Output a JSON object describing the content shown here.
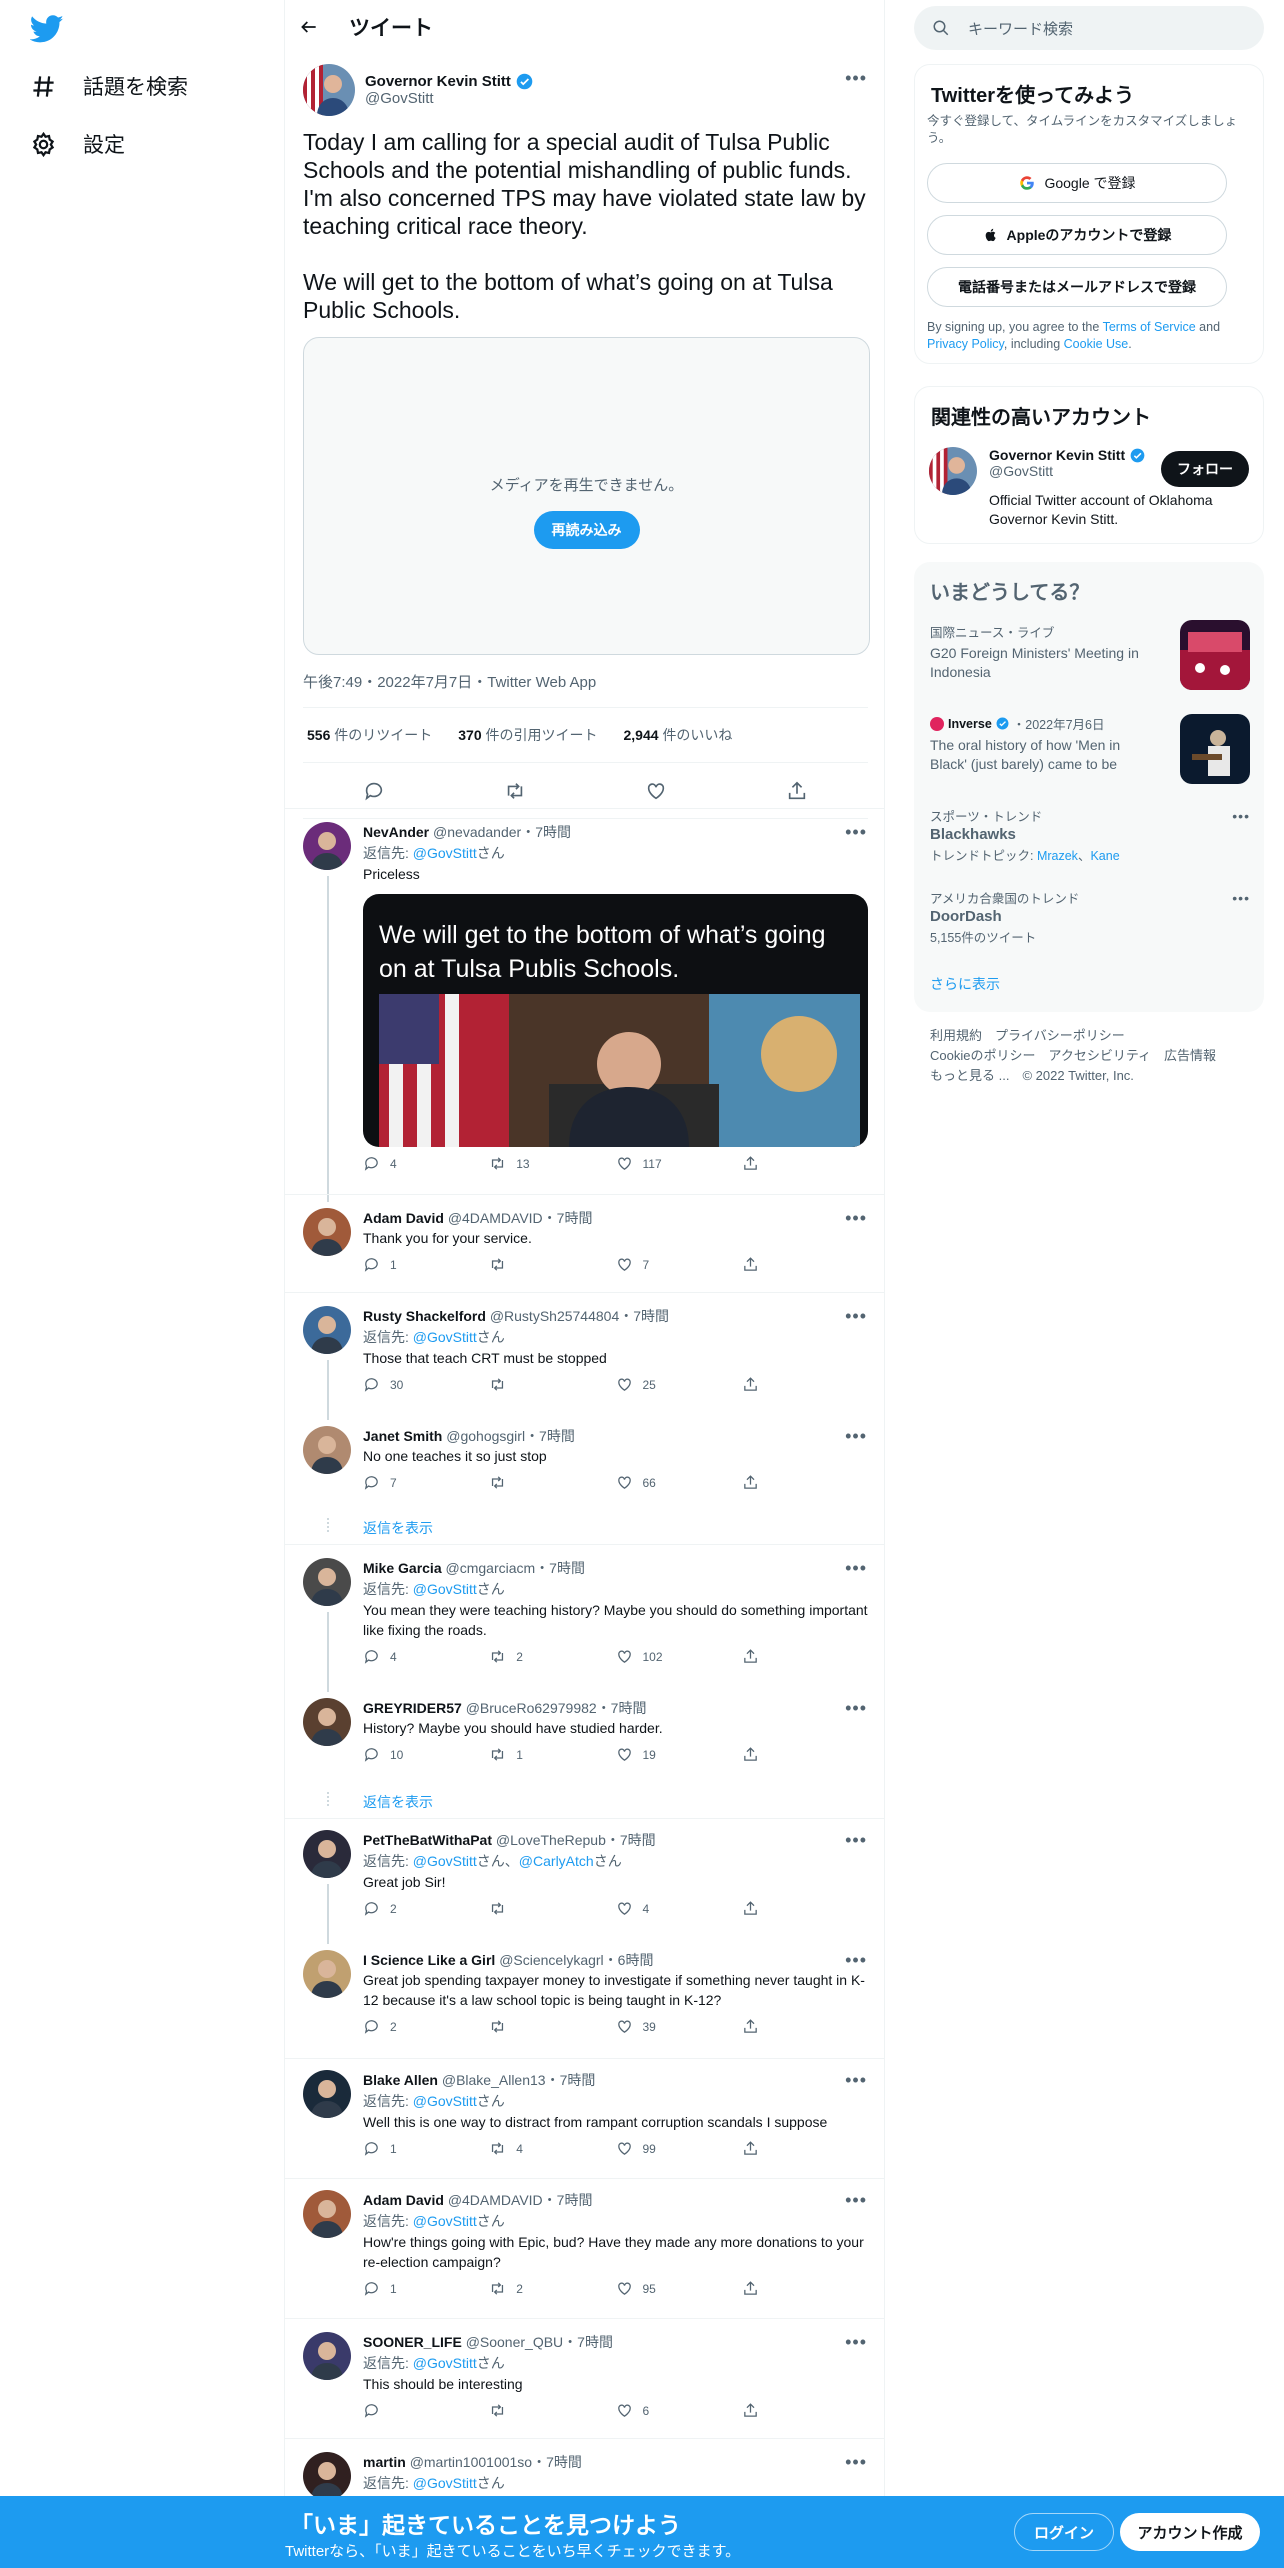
{
  "nav": {
    "explore_label": "話題を検索",
    "settings_label": "設定"
  },
  "header": {
    "title": "ツイート"
  },
  "tweet": {
    "author_name": "Governor Kevin Stitt",
    "author_handle": "@GovStitt",
    "text": "Today I am calling for a special audit of Tulsa Public Schools and the potential mishandling of public funds. I'm also concerned TPS may have violated state law by teaching critical race theory.\n\nWe will get to the bottom of what’s going on at Tulsa Public Schools.",
    "media_error": "メディアを再生できません。",
    "reload_label": "再読み込み",
    "meta": "午後7:49・2022年7月7日・Twitter Web App",
    "retweets_count": "556",
    "retweets_label": "件のリツイート",
    "quotes_count": "370",
    "quotes_label": "件の引用ツイート",
    "likes_count": "2,944",
    "likes_label": "件のいいね"
  },
  "replies": [
    {
      "name": "NevAnder",
      "handle": "@nevadander",
      "time": "・7時間",
      "replying": "返信先: ",
      "mention": "@GovStitt",
      "san": "さん",
      "text": "Priceless",
      "embed_caption": "We will get to the bottom of what’s going on at Tulsa Publis Schools.",
      "replies": "4",
      "retweets": "13",
      "likes": "117"
    },
    {
      "name": "Adam David",
      "handle": "@4DAMDAVID",
      "time": "・7時間",
      "text": "Thank you for your service.",
      "replies": "1",
      "retweets": "",
      "likes": "7"
    },
    {
      "name": "Rusty Shackelford",
      "handle": "@RustySh25744804",
      "time": "・7時間",
      "replying": "返信先: ",
      "mention": "@GovStitt",
      "san": "さん",
      "text": "Those that teach CRT must be stopped",
      "replies": "30",
      "retweets": "",
      "likes": "25"
    },
    {
      "name": "Janet Smith",
      "handle": "@gohogsgirl",
      "time": "・7時間",
      "text": "No one teaches it so just stop",
      "replies": "7",
      "retweets": "",
      "likes": "66"
    },
    {
      "name": "Mike Garcia",
      "handle": "@cmgarciacm",
      "time": "・7時間",
      "replying": "返信先: ",
      "mention": "@GovStitt",
      "san": "さん",
      "text": "You mean they were teaching history?  Maybe you should do something important like fixing the roads.",
      "replies": "4",
      "retweets": "2",
      "likes": "102"
    },
    {
      "name": "GREYRIDER57",
      "handle": "@BruceRo62979982",
      "time": "・7時間",
      "text": "History? Maybe you should have studied harder.",
      "replies": "10",
      "retweets": "1",
      "likes": "19"
    },
    {
      "name": "PetTheBatWithaPat",
      "handle": "@LoveTheRepub",
      "time": "・7時間",
      "replying": "返信先: ",
      "mention": "@GovStitt",
      "san": "さん、",
      "mention2": "@CarlyAtch",
      "san2": "さん",
      "text": "Great job Sir!",
      "replies": "2",
      "retweets": "",
      "likes": "4"
    },
    {
      "name": "I Science Like a Girl",
      "handle": "@Sciencelykagrl",
      "time": "・6時間",
      "text": "Great job spending taxpayer money to investigate if something never taught in K-12 because it's a law school topic is being taught in K-12?",
      "replies": "2",
      "retweets": "",
      "likes": "39"
    },
    {
      "name": "Blake Allen",
      "handle": "@Blake_Allen13",
      "time": "・7時間",
      "replying": "返信先: ",
      "mention": "@GovStitt",
      "san": "さん",
      "text": "Well this is one way to distract from rampant corruption scandals I suppose",
      "replies": "1",
      "retweets": "4",
      "likes": "99"
    },
    {
      "name": "Adam David",
      "handle": "@4DAMDAVID",
      "time": "・7時間",
      "replying": "返信先: ",
      "mention": "@GovStitt",
      "san": "さん",
      "text": "How're things going with Epic, bud? Have they made any more donations to your re-election campaign?",
      "replies": "1",
      "retweets": "2",
      "likes": "95"
    },
    {
      "name": "SOONER_LIFE",
      "handle": "@Sooner_QBU",
      "time": "・7時間",
      "replying": "返信先: ",
      "mention": "@GovStitt",
      "san": "さん",
      "text": "This should be interesting",
      "replies": "",
      "retweets": "",
      "likes": "6"
    },
    {
      "name": "martin",
      "handle": "@martin1001001so",
      "time": "・7時間",
      "replying": "返信先: ",
      "mention": "@GovStitt",
      "san": "さん"
    }
  ],
  "show_replies_label": "返信を表示",
  "right": {
    "search_placeholder": "キーワード検索",
    "signup_title": "Twitterを使ってみよう",
    "signup_sub": "今すぐ登録して、タイムラインをカスタマイズしましょう。",
    "google_btn": "Google で登録",
    "apple_btn": "Appleのアカウントで登録",
    "phone_btn": "電話番号またはメールアドレスで登録",
    "terms_pre": "By signing up, you agree to the ",
    "terms_link": "Terms of Service",
    "terms_and": " and ",
    "privacy_link": "Privacy Policy",
    "terms_incl": ", including ",
    "cookie_link": "Cookie Use",
    "terms_end": ".",
    "related_title": "関連性の高いアカウント",
    "related_name": "Governor Kevin Stitt",
    "related_handle": "@GovStitt",
    "related_bio": "Official Twitter account of Oklahoma Governor Kevin Stitt.",
    "follow_label": "フォロー",
    "trends_title": "いまどうしてる？",
    "trends": [
      {
        "cat": "国際ニュース・ライブ",
        "title": "G20 Foreign Ministers' Meeting in Indonesia"
      },
      {
        "cat_name": "Inverse",
        "cat_date": "・2022年7月6日",
        "title": "The oral history of how 'Men in Black' (just barely) came to be"
      },
      {
        "cat": "スポーツ・トレンド",
        "title": "Blackhawks",
        "sub_pre": "トレンドトピック: ",
        "sub_link1": "Mrazek",
        "sub_sep": "、",
        "sub_link2": "Kane"
      },
      {
        "cat": "アメリカ合衆国のトレンド",
        "title": "DoorDash",
        "sub": "5,155件のツイート"
      }
    ],
    "show_more": "さらに表示",
    "footer_line1": "利用規約　プライバシーポリシー",
    "footer_line2": "Cookieのポリシー　アクセシビリティ　広告情報",
    "footer_line3": "もっと見る ...　© 2022 Twitter, Inc."
  },
  "bottom": {
    "headline": "「いま」起きていることを見つけよう",
    "sub": "Twitterなら、「いま」起きていることをいち早くチェックできます。",
    "login": "ログイン",
    "signup": "アカウント作成"
  },
  "colors": {
    "accent": "#1d9bf0",
    "text": "#0f1419",
    "secondary": "#536471"
  }
}
